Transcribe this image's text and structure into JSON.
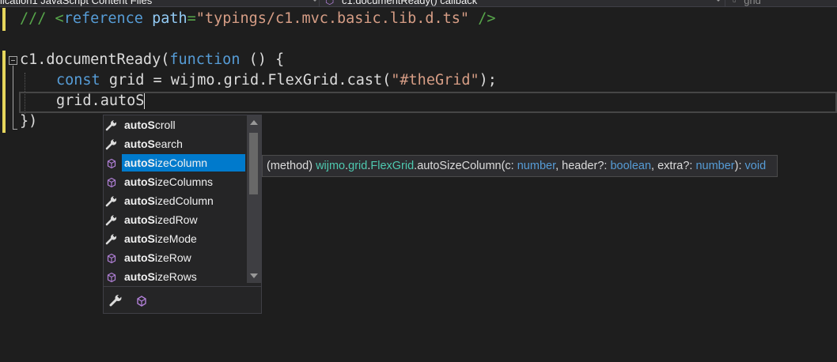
{
  "navbar": {
    "project_combo": "lication1 JavaScript Content Files",
    "scope_combo": "c1.documentReady() callback",
    "member_combo": "grid"
  },
  "code": {
    "line1": {
      "prefix": "/// <",
      "tag": "reference",
      "attr": "path",
      "eq": "=",
      "value": "\"typings/c1.mvc.basic.lib.d.ts\"",
      "close": " />"
    },
    "line3": {
      "start": "c1.documentReady(",
      "keyword": "function",
      "end": " () {"
    },
    "line4": {
      "keyword": "const",
      "mid": " grid = wijmo.grid.FlexGrid.cast(",
      "string": "\"#theGrid\"",
      "end": ");"
    },
    "line5": {
      "text": "grid.autoS"
    },
    "line6": {
      "text": "})"
    }
  },
  "completion": {
    "match": "autoS",
    "items": [
      {
        "match": "autoS",
        "rest": "croll",
        "icon": "wrench-icon"
      },
      {
        "match": "autoS",
        "rest": "earch",
        "icon": "wrench-icon"
      },
      {
        "match": "autoS",
        "rest": "izeColumn",
        "icon": "method-cube-icon",
        "selected": true
      },
      {
        "match": "autoS",
        "rest": "izeColumns",
        "icon": "method-cube-icon"
      },
      {
        "match": "autoS",
        "rest": "izedColumn",
        "icon": "wrench-icon"
      },
      {
        "match": "autoS",
        "rest": "izedRow",
        "icon": "wrench-icon"
      },
      {
        "match": "autoS",
        "rest": "izeMode",
        "icon": "wrench-icon"
      },
      {
        "match": "autoS",
        "rest": "izeRow",
        "icon": "method-cube-icon"
      },
      {
        "match": "autoS",
        "rest": "izeRows",
        "icon": "method-cube-icon"
      }
    ],
    "filters": [
      "wrench-icon",
      "method-cube-icon"
    ]
  },
  "tooltip": {
    "kind": "(method) ",
    "ns1": "wijmo",
    "dot1": ".",
    "ns2": "grid",
    "dot2": ".",
    "cls": "FlexGrid",
    "method": ".autoSizeColumn(c: ",
    "t1": "number",
    "p2": ", header?: ",
    "t2": "boolean",
    "p3": ", extra?: ",
    "t3": "number",
    "p4": "): ",
    "t4": "void"
  },
  "colors": {
    "background": "#1e1e1e",
    "keyword": "#569cd6",
    "comment": "#57a64a",
    "string": "#d69d85",
    "selection": "#007acc",
    "type": "#4ec9b0"
  }
}
